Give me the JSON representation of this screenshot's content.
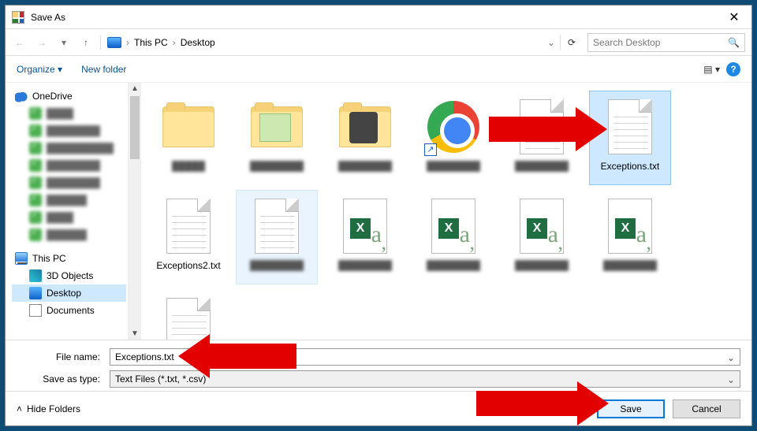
{
  "window": {
    "title": "Save As"
  },
  "nav": {
    "crumb_pc": "This PC",
    "crumb_desktop": "Desktop",
    "search_placeholder": "Search Desktop"
  },
  "toolbar": {
    "organize": "Organize",
    "newfolder": "New folder"
  },
  "tree": {
    "onedrive": "OneDrive",
    "thispc": "This PC",
    "threed": "3D Objects",
    "desktop": "Desktop",
    "documents": "Documents"
  },
  "files": {
    "row1": {
      "exceptions": "Exceptions.txt",
      "exceptions2": "Exceptions2.txt"
    }
  },
  "form": {
    "filename_label": "File name:",
    "filename_value": "Exceptions.txt",
    "saveastype_label": "Save as type:",
    "saveastype_value": "Text Files (*.txt, *.csv)"
  },
  "footer": {
    "hide": "Hide Folders",
    "save": "Save",
    "cancel": "Cancel"
  }
}
